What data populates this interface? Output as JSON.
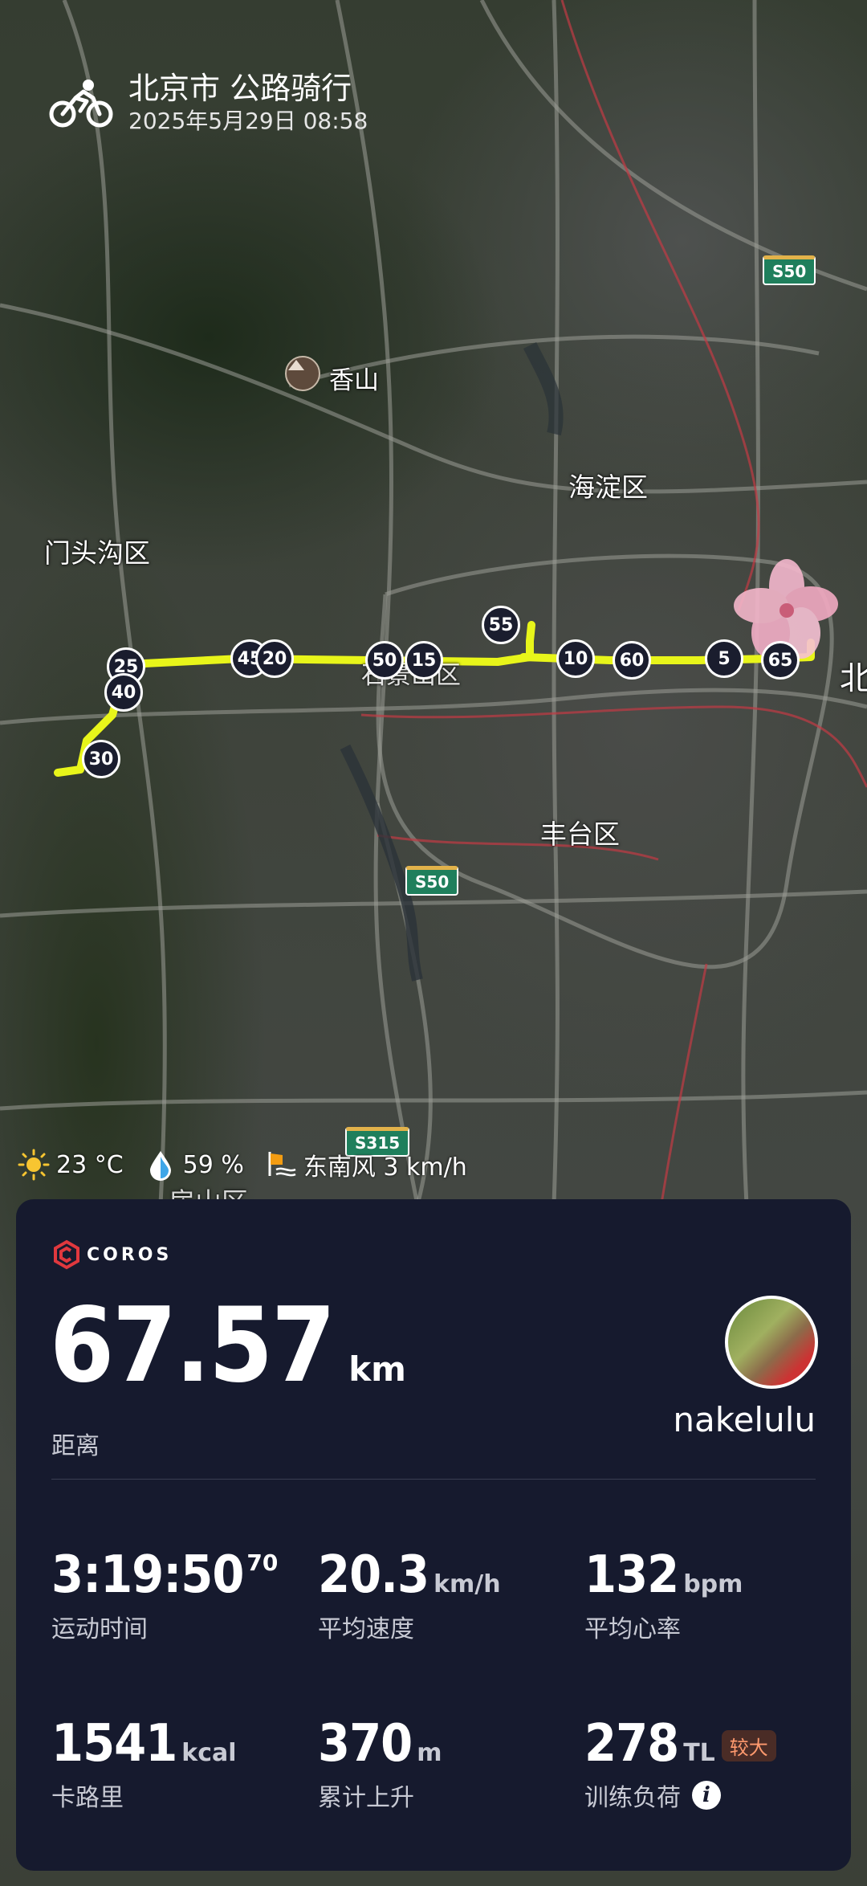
{
  "header": {
    "title": "北京市 公路骑行",
    "datetime": "2025年5月29日 08:58"
  },
  "map": {
    "places": {
      "xiangshan": "香山",
      "haidian": "海淀区",
      "mentougou": "门头沟区",
      "shijingshan": "石景山区",
      "fengtai": "丰台区",
      "fangshan": "房山区",
      "beijing_edge": "北"
    },
    "road_signs": [
      "S50",
      "S50",
      "S315"
    ],
    "km_markers": [
      "25",
      "40",
      "30",
      "45",
      "20",
      "50",
      "15",
      "55",
      "10",
      "60",
      "5",
      "65"
    ],
    "route_color": "#e8f51a"
  },
  "weather": {
    "temperature": "23 °C",
    "humidity": "59 %",
    "wind": "东南风 3 km/h"
  },
  "card": {
    "brand": "COROS",
    "distance_value": "67.57",
    "distance_unit": "km",
    "distance_label": "距离",
    "username": "nakelulu",
    "stats": {
      "time": {
        "value": "3:19:50",
        "fraction": "70",
        "label": "运动时间"
      },
      "speed": {
        "value": "20.3",
        "unit": "km/h",
        "label": "平均速度"
      },
      "heart_rate": {
        "value": "132",
        "unit": "bpm",
        "label": "平均心率"
      },
      "calories": {
        "value": "1541",
        "unit": "kcal",
        "label": "卡路里"
      },
      "elevation": {
        "value": "370",
        "unit": "m",
        "label": "累计上升"
      },
      "training_load": {
        "value": "278",
        "unit": "TL",
        "badge": "较大",
        "label": "训练负荷"
      }
    }
  },
  "colors": {
    "card_bg": "#161a2e",
    "accent_red": "#e0383e",
    "badge_text": "#ff9a6e"
  }
}
